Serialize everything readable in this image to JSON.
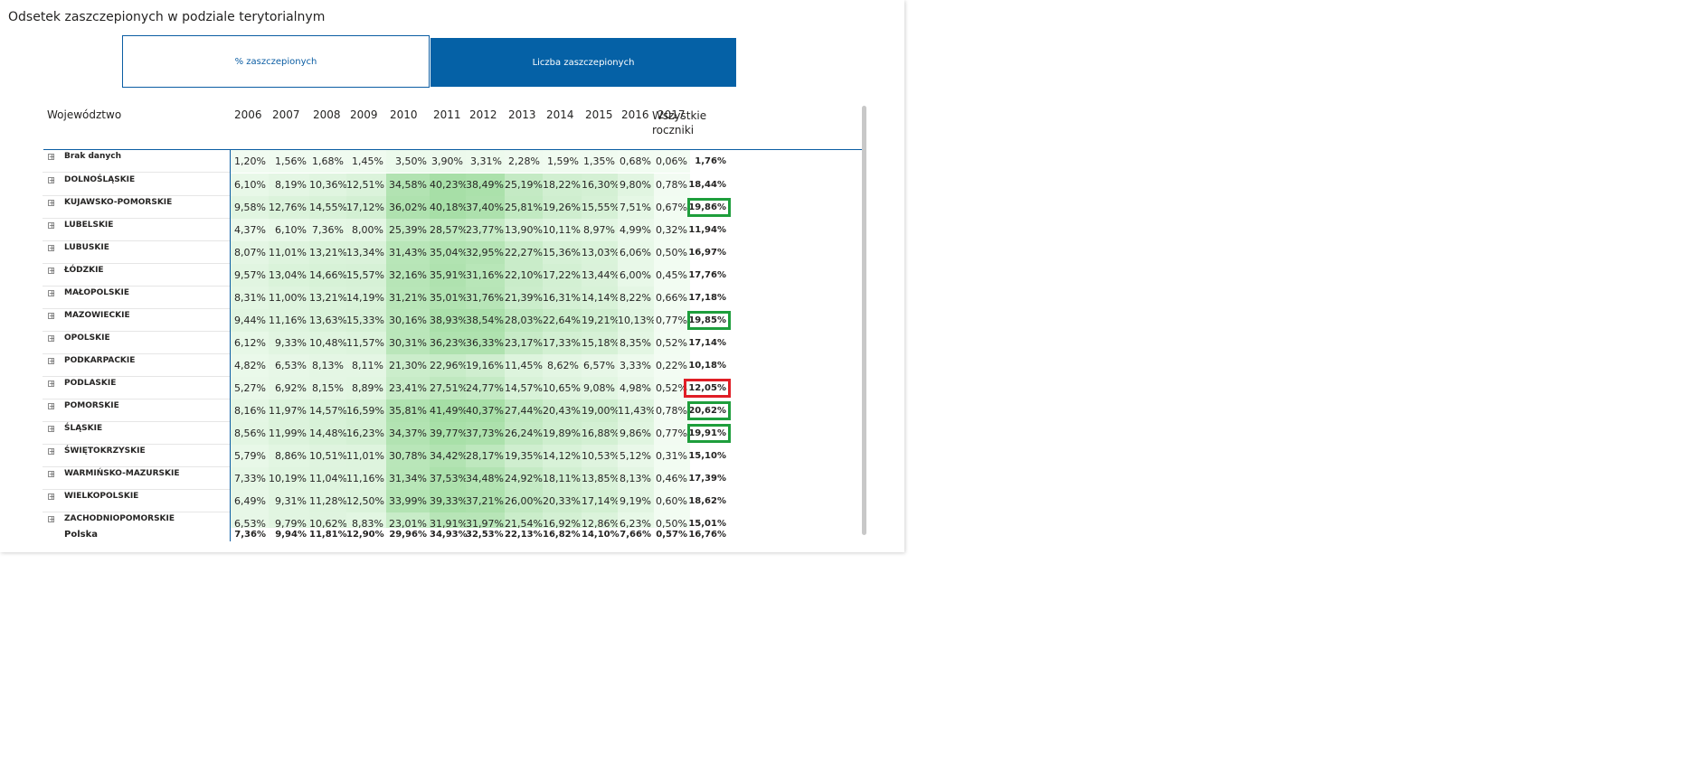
{
  "title": "Odsetek zaszczepionych w podziale terytorialnym",
  "tabs": {
    "pct": "% zaszczepionych",
    "count": "Liczba zaszczepionych"
  },
  "table": {
    "region_header": "Województwo",
    "years": [
      "2006",
      "2007",
      "2008",
      "2009",
      "2010",
      "2011",
      "2012",
      "2013",
      "2014",
      "2015",
      "2016",
      "2017"
    ],
    "total_header_1": "Wszystkie",
    "total_header_2": "roczniki",
    "rows": [
      {
        "name": "Brak danych",
        "values": [
          "1,20%",
          "1,56%",
          "1,68%",
          "1,45%",
          "3,50%",
          "3,90%",
          "3,31%",
          "2,28%",
          "1,59%",
          "1,35%",
          "0,68%",
          "0,06%"
        ],
        "total": "1,76%",
        "flag": ""
      },
      {
        "name": "DOLNOŚLĄSKIE",
        "values": [
          "6,10%",
          "8,19%",
          "10,36%",
          "12,51%",
          "34,58%",
          "40,23%",
          "38,49%",
          "25,19%",
          "18,22%",
          "16,30%",
          "9,80%",
          "0,78%"
        ],
        "total": "18,44%",
        "flag": ""
      },
      {
        "name": "KUJAWSKO-POMORSKIE",
        "values": [
          "9,58%",
          "12,76%",
          "14,55%",
          "17,12%",
          "36,02%",
          "40,18%",
          "37,40%",
          "25,81%",
          "19,26%",
          "15,55%",
          "7,51%",
          "0,67%"
        ],
        "total": "19,86%",
        "flag": "green"
      },
      {
        "name": "LUBELSKIE",
        "values": [
          "4,37%",
          "6,10%",
          "7,36%",
          "8,00%",
          "25,39%",
          "28,57%",
          "23,77%",
          "13,90%",
          "10,11%",
          "8,97%",
          "4,99%",
          "0,32%"
        ],
        "total": "11,94%",
        "flag": ""
      },
      {
        "name": "LUBUSKIE",
        "values": [
          "8,07%",
          "11,01%",
          "13,21%",
          "13,34%",
          "31,43%",
          "35,04%",
          "32,95%",
          "22,27%",
          "15,36%",
          "13,03%",
          "6,06%",
          "0,50%"
        ],
        "total": "16,97%",
        "flag": ""
      },
      {
        "name": "ŁÓDZKIE",
        "values": [
          "9,57%",
          "13,04%",
          "14,66%",
          "15,57%",
          "32,16%",
          "35,91%",
          "31,16%",
          "22,10%",
          "17,22%",
          "13,44%",
          "6,00%",
          "0,45%"
        ],
        "total": "17,76%",
        "flag": ""
      },
      {
        "name": "MAŁOPOLSKIE",
        "values": [
          "8,31%",
          "11,00%",
          "13,21%",
          "14,19%",
          "31,21%",
          "35,01%",
          "31,76%",
          "21,39%",
          "16,31%",
          "14,14%",
          "8,22%",
          "0,66%"
        ],
        "total": "17,18%",
        "flag": ""
      },
      {
        "name": "MAZOWIECKIE",
        "values": [
          "9,44%",
          "11,16%",
          "13,63%",
          "15,33%",
          "30,16%",
          "38,93%",
          "38,54%",
          "28,03%",
          "22,64%",
          "19,21%",
          "10,13%",
          "0,77%"
        ],
        "total": "19,85%",
        "flag": "green"
      },
      {
        "name": "OPOLSKIE",
        "values": [
          "6,12%",
          "9,33%",
          "10,48%",
          "11,57%",
          "30,31%",
          "36,23%",
          "36,33%",
          "23,17%",
          "17,33%",
          "15,18%",
          "8,35%",
          "0,52%"
        ],
        "total": "17,14%",
        "flag": ""
      },
      {
        "name": "PODKARPACKIE",
        "values": [
          "4,82%",
          "6,53%",
          "8,13%",
          "8,11%",
          "21,30%",
          "22,96%",
          "19,16%",
          "11,45%",
          "8,62%",
          "6,57%",
          "3,33%",
          "0,22%"
        ],
        "total": "10,18%",
        "flag": ""
      },
      {
        "name": "PODLASKIE",
        "values": [
          "5,27%",
          "6,92%",
          "8,15%",
          "8,89%",
          "23,41%",
          "27,51%",
          "24,77%",
          "14,57%",
          "10,65%",
          "9,08%",
          "4,98%",
          "0,52%"
        ],
        "total": "12,05%",
        "flag": "red"
      },
      {
        "name": "POMORSKIE",
        "values": [
          "8,16%",
          "11,97%",
          "14,57%",
          "16,59%",
          "35,81%",
          "41,49%",
          "40,37%",
          "27,44%",
          "20,43%",
          "19,00%",
          "11,43%",
          "0,78%"
        ],
        "total": "20,62%",
        "flag": "green"
      },
      {
        "name": "ŚLĄSKIE",
        "values": [
          "8,56%",
          "11,99%",
          "14,48%",
          "16,23%",
          "34,37%",
          "39,77%",
          "37,73%",
          "26,24%",
          "19,89%",
          "16,88%",
          "9,86%",
          "0,77%"
        ],
        "total": "19,91%",
        "flag": "green"
      },
      {
        "name": "ŚWIĘTOKRZYSKIE",
        "values": [
          "5,79%",
          "8,86%",
          "10,51%",
          "11,01%",
          "30,78%",
          "34,42%",
          "28,17%",
          "19,35%",
          "14,12%",
          "10,53%",
          "5,12%",
          "0,31%"
        ],
        "total": "15,10%",
        "flag": ""
      },
      {
        "name": "WARMIŃSKO-MAZURSKIE",
        "values": [
          "7,33%",
          "10,19%",
          "11,04%",
          "11,16%",
          "31,34%",
          "37,53%",
          "34,48%",
          "24,92%",
          "18,11%",
          "13,85%",
          "8,13%",
          "0,46%"
        ],
        "total": "17,39%",
        "flag": ""
      },
      {
        "name": "WIELKOPOLSKIE",
        "values": [
          "6,49%",
          "9,31%",
          "11,28%",
          "12,50%",
          "33,99%",
          "39,33%",
          "37,21%",
          "26,00%",
          "20,33%",
          "17,14%",
          "9,19%",
          "0,60%"
        ],
        "total": "18,62%",
        "flag": ""
      },
      {
        "name": "ZACHODNIOPOMORSKIE",
        "values": [
          "6,53%",
          "9,79%",
          "10,62%",
          "8,83%",
          "23,01%",
          "31,91%",
          "31,97%",
          "21,54%",
          "16,92%",
          "12,86%",
          "6,23%",
          "0,50%"
        ],
        "total": "15,01%",
        "flag": ""
      }
    ],
    "footer": {
      "name": "Polska",
      "values": [
        "7,36%",
        "9,94%",
        "11,81%",
        "12,90%",
        "29,96%",
        "34,93%",
        "32,53%",
        "22,13%",
        "16,82%",
        "14,10%",
        "7,66%",
        "0,57%"
      ],
      "total": "16,76%"
    }
  },
  "colors": {
    "accent": "#0561A6",
    "flag_green": "#1E9E3C",
    "flag_red": "#E01E26",
    "heat_low": "#F2FCF2",
    "heat_high": "#A6E0A6"
  }
}
